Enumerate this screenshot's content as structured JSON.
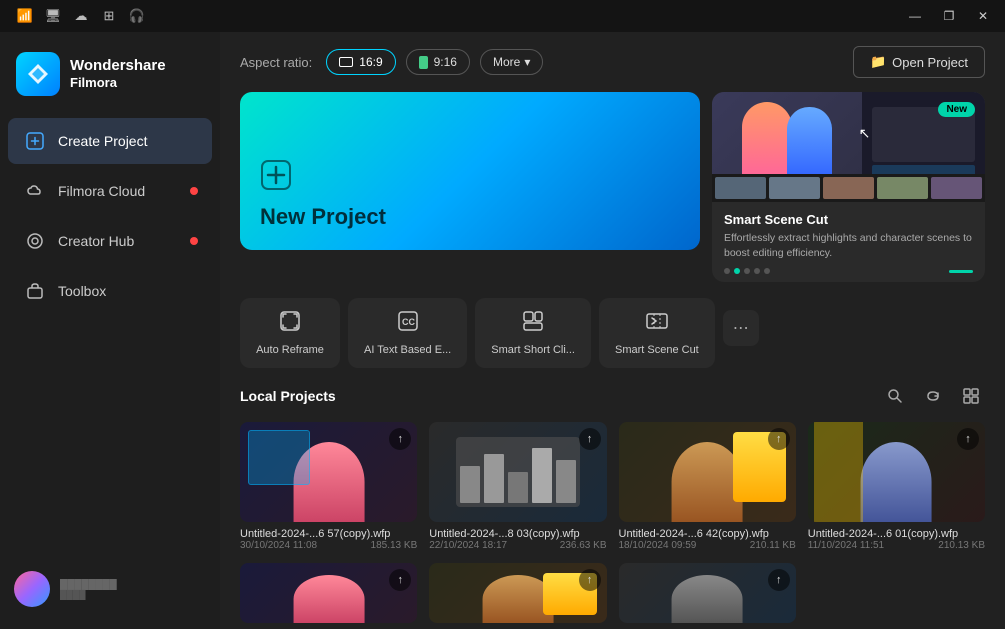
{
  "titlebar": {
    "title": "Wondershare Filmora",
    "minimize": "—",
    "restore": "❐",
    "close": "✕"
  },
  "statusIcons": [
    "wifi",
    "display",
    "cloud",
    "grid",
    "headset"
  ],
  "sidebar": {
    "logo": {
      "title": "Wondershare",
      "subtitle": "Filmora"
    },
    "items": [
      {
        "id": "create-project",
        "label": "Create Project",
        "icon": "➕",
        "active": true,
        "dot": false
      },
      {
        "id": "filmora-cloud",
        "label": "Filmora Cloud",
        "icon": "☁",
        "active": false,
        "dot": true
      },
      {
        "id": "creator-hub",
        "label": "Creator Hub",
        "icon": "◎",
        "active": false,
        "dot": true
      },
      {
        "id": "toolbox",
        "label": "Toolbox",
        "icon": "⬡",
        "active": false,
        "dot": false
      }
    ],
    "user": {
      "name": "User Account"
    }
  },
  "aspectBar": {
    "label": "Aspect ratio:",
    "options": [
      {
        "id": "16-9",
        "label": "16:9",
        "selected": true
      },
      {
        "id": "9-16",
        "label": "9:16",
        "selected": false
      }
    ],
    "more": "More",
    "openProject": "Open Project"
  },
  "newProject": {
    "icon": "⊕",
    "label": "New Project"
  },
  "featureCard": {
    "badge": "New",
    "title": "Smart Scene Cut",
    "description": "Effortlessly extract highlights and character scenes to boost editing efficiency.",
    "dots": [
      false,
      true,
      false,
      false,
      false
    ]
  },
  "tools": [
    {
      "id": "auto-reframe",
      "icon": "↗",
      "label": "Auto Reframe"
    },
    {
      "id": "ai-text-based",
      "icon": "CC",
      "label": "AI Text Based E..."
    },
    {
      "id": "smart-short-clip",
      "icon": "⬛",
      "label": "Smart Short Cli..."
    },
    {
      "id": "smart-scene-cut",
      "icon": "✂",
      "label": "Smart Scene Cut"
    }
  ],
  "toolsMore": "⋯",
  "localProjects": {
    "title": "Local Projects",
    "projects": [
      {
        "id": "proj1",
        "name": "Untitled-2024-...6 57(copy).wfp",
        "date": "30/10/2024 11:08",
        "size": "185.13 KB",
        "thumbBg": "thumb-bg-1",
        "personClass": "thumb-p1"
      },
      {
        "id": "proj2",
        "name": "Untitled-2024-...8 03(copy).wfp",
        "date": "22/10/2024 18:17",
        "size": "236.63 KB",
        "thumbBg": "thumb-bg-2",
        "personClass": "thumb-p2"
      },
      {
        "id": "proj3",
        "name": "Untitled-2024-...6 42(copy).wfp",
        "date": "18/10/2024 09:59",
        "size": "210.11 KB",
        "thumbBg": "thumb-bg-3",
        "personClass": "thumb-p3"
      },
      {
        "id": "proj4",
        "name": "Untitled-2024-...6 01(copy).wfp",
        "date": "11/10/2024 11:51",
        "size": "210.13 KB",
        "thumbBg": "thumb-bg-4",
        "personClass": "thumb-p4"
      }
    ],
    "bottomProjects": [
      {
        "id": "bproj1",
        "thumbBg": "thumb-bg-1"
      },
      {
        "id": "bproj2",
        "thumbBg": "thumb-bg-2"
      },
      {
        "id": "bproj3",
        "thumbBg": "thumb-bg-3"
      }
    ]
  }
}
